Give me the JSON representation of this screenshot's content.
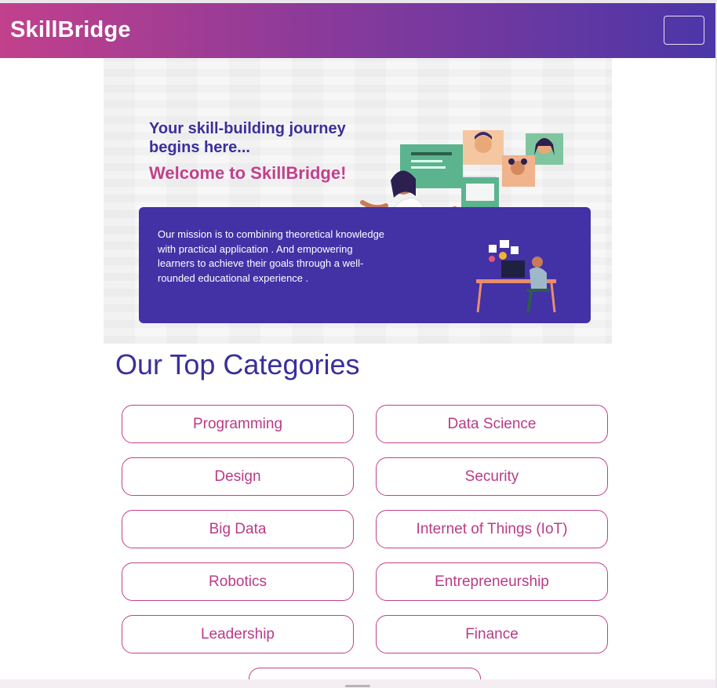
{
  "navbar": {
    "brand": "SkillBridge",
    "toggler_icon": "hamburger-menu-icon"
  },
  "hero": {
    "headline": "Your skill-building journey begins here...",
    "welcome": "Welcome to SkillBridge!",
    "mission": "Our mission is to combining theoretical knowledge with practical application . And empowering learners to achieve their goals through a well-rounded educational experience .",
    "colors": {
      "accent_purple": "#3b2f9a",
      "accent_pink": "#c2408c",
      "panel": "#4331a6"
    }
  },
  "categories": {
    "title": "Our Top Categories",
    "items": [
      "Programming",
      "Data Science",
      "Design",
      "Security",
      "Big Data",
      "Internet of Things (IoT)",
      "Robotics",
      "Entrepreneurship",
      "Leadership",
      "Finance"
    ]
  }
}
